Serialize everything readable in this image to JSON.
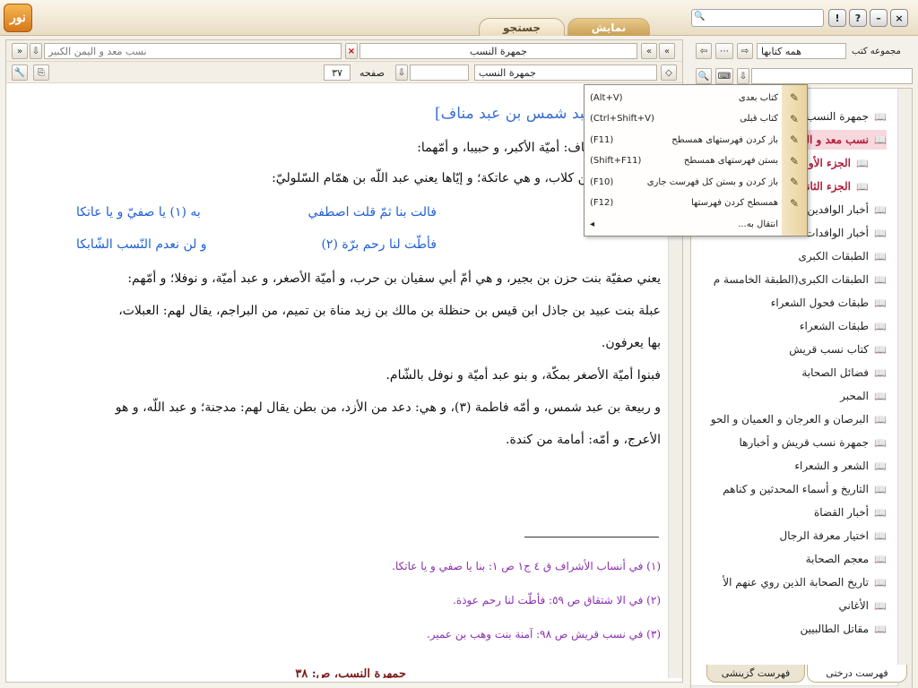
{
  "app": {
    "logo_text": "نور",
    "tabs": [
      {
        "label": "نمایش",
        "active": true
      },
      {
        "label": "جستجو",
        "active": false
      }
    ],
    "window_controls": [
      "!",
      "?",
      "–",
      "×"
    ]
  },
  "left_bar1": {
    "next_label": "»",
    "prev_label": "«",
    "down_label": "⇩",
    "book_tab1": "جمهرة النسب",
    "close_label": "×",
    "book_tab2": "نسب معد و اليمن الكبير"
  },
  "left_bar2": {
    "page_label": "صفحه",
    "page_value": "٣٧",
    "book_field": "جمهرة النسب"
  },
  "document": {
    "title": "[وعبد شمس بن عبد مناف]",
    "line1": "مس بن عبد مناف: أميّة الأكبر، و حبيبا، و أمّهما:",
    "line2": "بيد بن رؤاس بن كلاب، و هي عاتكة؛ و إيّاها يعني عبد اللّه بن همّام السّلوليّ:",
    "poem1_right": "فالت بنا ثمّ قلت اصطفي",
    "poem1_left": "به (١) يا صفيّ و يا عاتكا",
    "poem2_right": "فأطّت لنا رحم برّة (٢)",
    "poem2_left": "و لن نعدم النّسب الشّابكا",
    "line3": "يعني صفيّة بنت حزن بن بجير، و هي أمّ أبي سفيان بن حرب، و أميّة الأصغر، و عبد أميّة، و نوفلا؛ و أمّهم:",
    "line4": "عبلة بنت عبيد بن جاذل ابن قيس بن حنظلة بن مالك بن زيد مناة بن تميم، من البراجم، يقال لهم: العبلات،",
    "line5": "بها يعرفون.",
    "line6": "فبنوا أميّة الأصغر بمكّة، و بنو عبد أميّة و نوفل بالشّام.",
    "line7": "و ربيعة بن عبد شمس، و أمّه فاطمة (٣)، و هي: دعد من الأزد، من بطن يقال لهم: مدجنة؛ و عبد اللّه، و هو",
    "line8": "الأعرج، و أمّه: أمامة من كندة.",
    "footnotes": [
      "(١) في أنساب الأشراف ق ٤ ج١ ص ١: بنا يا صفي و يا عاتكا.",
      "(٢) في الا شتقاق ص ٥٩: فأطّت لنا رحم عوذة.",
      "(٣) في نسب قريش ص ٩٨: آمنة بنت وهب بن عمير."
    ],
    "footer": "جمهرة النسب، ص: ٣٨"
  },
  "menu": {
    "items": [
      {
        "label": "كتاب بعدی",
        "shortcut": "(Alt+V)",
        "icon": "next-book-icon"
      },
      {
        "label": "كتاب قبلی",
        "shortcut": "(Ctrl+Shift+V)",
        "icon": "prev-book-icon"
      },
      {
        "label": "باز كردن فهرستهای همسطح",
        "shortcut": "(F11)",
        "icon": "expand-level-icon"
      },
      {
        "label": "بستن فهرستهای همسطح",
        "shortcut": "(Shift+F11)",
        "icon": "collapse-level-icon"
      },
      {
        "label": "باز كردن و بستن كل فهرست جاری",
        "shortcut": "(F10)",
        "icon": "toggle-tree-icon"
      },
      {
        "label": "همسطح كردن فهرستها",
        "shortcut": "(F12)",
        "icon": "flatten-icon"
      },
      {
        "label": "انتقال به...",
        "shortcut": "◂",
        "icon": ""
      }
    ]
  },
  "right_panel": {
    "collection_label": "مجموعه كتب",
    "collection_value": "همه كتابها",
    "tree_items": [
      {
        "label": "جمهرة النسب",
        "selected": false
      },
      {
        "label": "نسب معد و اليمن الكبير",
        "selected": true
      },
      {
        "label": "الجزء الأول",
        "selected": true
      },
      {
        "label": "الجزء الثاني",
        "selected": true
      },
      {
        "label": "أخبار الوافدين",
        "selected": false
      },
      {
        "label": "أخبار الوافدات",
        "selected": false
      },
      {
        "label": "الطبقات الكبرى",
        "selected": false
      },
      {
        "label": "الطبقات الكبرى(الطبقة الخامسة م",
        "selected": false
      },
      {
        "label": "طبقات فحول الشعراء",
        "selected": false
      },
      {
        "label": "طبقات الشعراء",
        "selected": false
      },
      {
        "label": "كتاب نسب قريش",
        "selected": false
      },
      {
        "label": "فضائل الصحابة",
        "selected": false
      },
      {
        "label": "المحبر",
        "selected": false
      },
      {
        "label": "البرصان و العرجان و العميان و الحو",
        "selected": false
      },
      {
        "label": "جمهرة نسب قريش و أخبارها",
        "selected": false
      },
      {
        "label": "الشعر و الشعراء",
        "selected": false
      },
      {
        "label": "التاريخ و أسماء المحدثين و كناهم",
        "selected": false
      },
      {
        "label": "أخبار القضاة",
        "selected": false
      },
      {
        "label": "اختيار معرفة الرجال",
        "selected": false
      },
      {
        "label": "معجم الصحابة",
        "selected": false
      },
      {
        "label": "تاريخ الصحابة الذين روي عنهم الأ",
        "selected": false
      },
      {
        "label": "الأغاني",
        "selected": false
      },
      {
        "label": "مقاتل الطالبيين",
        "selected": false
      }
    ],
    "bottom_tabs": [
      "فهرست درختی",
      "فهرست گزینشی"
    ]
  }
}
